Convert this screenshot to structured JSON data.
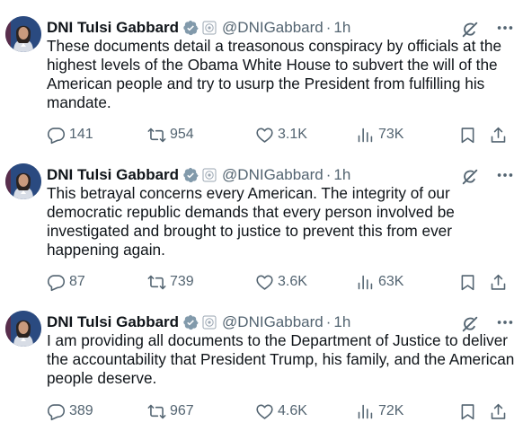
{
  "colors": {
    "text": "#0f1419",
    "secondary": "#536471",
    "verified_gray": "#829aab"
  },
  "tweets": [
    {
      "author": {
        "name": "DNI Tulsi Gabbard",
        "handle": "@DNIGabbard",
        "time": "1h",
        "separator": "·"
      },
      "text": "These documents detail a treasonous conspiracy by officials at the highest levels of the Obama White House to subvert the will of the American people and try to usurp the President from fulfilling his mandate.",
      "stats": {
        "replies": "141",
        "reposts": "954",
        "likes": "3.1K",
        "views": "73K"
      }
    },
    {
      "author": {
        "name": "DNI Tulsi Gabbard",
        "handle": "@DNIGabbard",
        "time": "1h",
        "separator": "·"
      },
      "text": "This betrayal concerns every American. The integrity of our democratic republic demands that every person involved be investigated and brought to justice to prevent this from ever happening again.",
      "stats": {
        "replies": "87",
        "reposts": "739",
        "likes": "3.6K",
        "views": "63K"
      }
    },
    {
      "author": {
        "name": "DNI Tulsi Gabbard",
        "handle": "@DNIGabbard",
        "time": "1h",
        "separator": "·"
      },
      "text": "I am providing all documents to the Department of Justice to deliver the accountability that President Trump, his family, and the American people deserve.",
      "stats": {
        "replies": "389",
        "reposts": "967",
        "likes": "4.6K",
        "views": "72K"
      }
    }
  ]
}
